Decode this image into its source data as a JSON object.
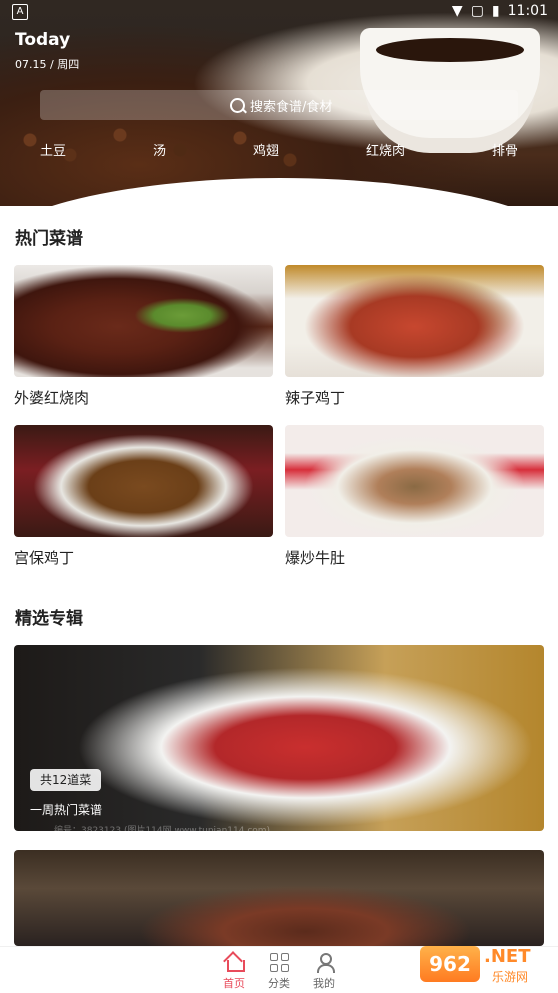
{
  "status": {
    "left_icon": "A",
    "time": "11:01",
    "icons": [
      "wifi-icon",
      "no-sim-icon",
      "battery-icon"
    ]
  },
  "hero": {
    "title": "Today",
    "date": "07.15",
    "weekday": "周四",
    "search_placeholder": "搜索食谱/食材",
    "tags": [
      "土豆",
      "汤",
      "鸡翅",
      "红烧肉",
      "排骨"
    ]
  },
  "sections": {
    "hot": {
      "title": "热门菜谱",
      "items": [
        {
          "label": "外婆红烧肉"
        },
        {
          "label": "辣子鸡丁"
        },
        {
          "label": "宫保鸡丁"
        },
        {
          "label": "爆炒牛肚"
        }
      ]
    },
    "featured": {
      "title": "精选专辑",
      "cards": [
        {
          "tag": "共12道菜",
          "title": "一周热门菜谱",
          "watermark": "编号：3823123 (图片114网 www.tupian114.com)"
        }
      ]
    }
  },
  "bottom_nav": [
    {
      "label": "首页",
      "active": true
    },
    {
      "label": "分类",
      "active": false
    },
    {
      "label": "我的",
      "active": false
    }
  ],
  "watermark_logo": {
    "badge": "962",
    "domain": ".NET",
    "brand": "乐游网"
  },
  "colors": {
    "accent": "#e84b5b",
    "text": "#222222",
    "muted": "#666666"
  }
}
